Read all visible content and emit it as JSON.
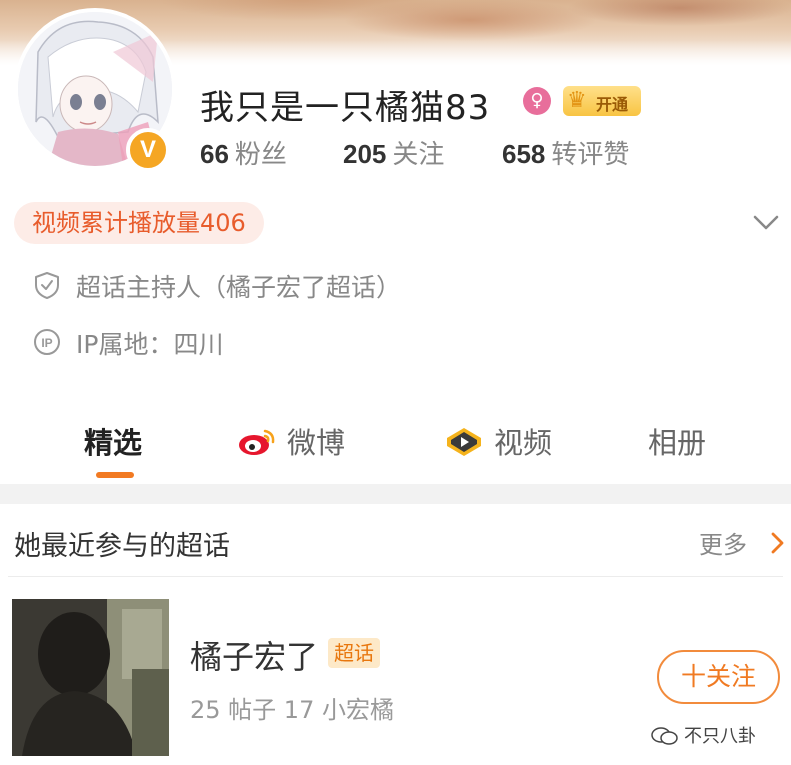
{
  "profile": {
    "username": "我只是一只橘猫83",
    "vip_label": "开通",
    "verified_mark": "V",
    "gender_symbol": "♀",
    "stats": {
      "fans_count": "66",
      "fans_label": "粉丝",
      "following_count": "205",
      "following_label": "关注",
      "interactions_count": "658",
      "interactions_label": "转评赞"
    },
    "video_plays_pill": "视频累计播放量406",
    "host_role": "超话主持人（橘子宏了超话）",
    "ip_location": "IP属地：四川"
  },
  "tabs": [
    {
      "label": "精选",
      "active": true
    },
    {
      "label": "微博",
      "icon": "weibo-logo-icon"
    },
    {
      "label": "视频",
      "icon": "video-play-icon"
    },
    {
      "label": "相册"
    }
  ],
  "super_topics": {
    "section_title": "她最近参与的超话",
    "more_label": "更多",
    "items": [
      {
        "name": "橘子宏了",
        "tag": "超话",
        "meta": "25 帖子 17 小宏橘",
        "follow_label": "十关注"
      }
    ]
  },
  "watermark": "不只八卦",
  "colors": {
    "accent_orange": "#f27a22",
    "pill_bg": "#fdece7",
    "pill_text": "#e85c2c",
    "vip_gold": "#f8c443",
    "gender_pink": "#e86e9b",
    "verified_gold": "#f5a623"
  }
}
